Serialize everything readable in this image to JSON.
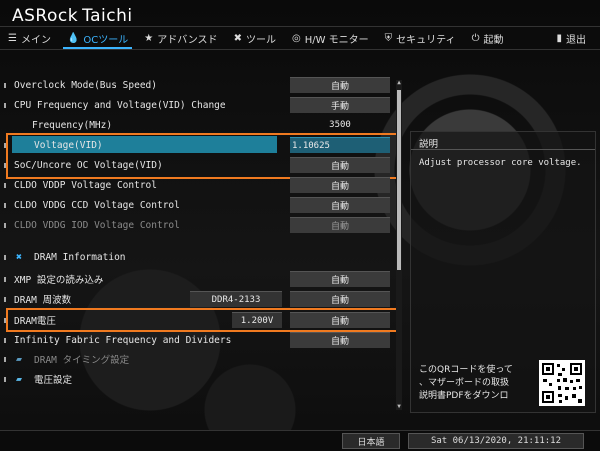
{
  "app": {
    "brand": "ASRock",
    "model": "Taichi"
  },
  "nav": {
    "tabs": [
      {
        "label": "メイン",
        "icon": "list-icon"
      },
      {
        "label": "OCツール",
        "icon": "drop-icon"
      },
      {
        "label": "アドバンスド",
        "icon": "star-icon"
      },
      {
        "label": "ツール",
        "icon": "tools-icon"
      },
      {
        "label": "H/W モニター",
        "icon": "monitor-icon"
      },
      {
        "label": "セキュリティ",
        "icon": "shield-icon"
      },
      {
        "label": "起動",
        "icon": "power-icon"
      },
      {
        "label": "退出",
        "icon": "exit-icon"
      }
    ],
    "active": "OCツール"
  },
  "settings": {
    "overclock_mode": {
      "label": "Overclock Mode(Bus Speed)",
      "value": "自動"
    },
    "cpu_freq_voltage": {
      "label": "CPU Frequency and Voltage(VID) Change",
      "value": "手動"
    },
    "frequency": {
      "label": "Frequency(MHz)",
      "value": "3500"
    },
    "voltage": {
      "label": "Voltage(VID)",
      "value": "1.10625"
    },
    "soc_voltage": {
      "label": "SoC/Uncore OC Voltage(VID)",
      "value": "自動"
    },
    "cldo_vddp": {
      "label": "CLDO VDDP Voltage Control",
      "value": "自動"
    },
    "cldo_vddg_ccd": {
      "label": "CLDO VDDG CCD Voltage Control",
      "value": "自動"
    },
    "cldo_vddg_iod": {
      "label": "CLDO VDDG IOD Voltage Control",
      "value": "自動"
    },
    "dram_info": {
      "label": "DRAM Information"
    },
    "xmp": {
      "label": "XMP 設定の読み込み",
      "value": "自動"
    },
    "dram_freq": {
      "label": "DRAM 周波数",
      "current": "DDR4-2133",
      "value": "自動"
    },
    "dram_voltage": {
      "label": "DRAM電圧",
      "current": "1.200V",
      "value": "自動"
    },
    "infinity_fabric": {
      "label": "Infinity Fabric Frequency and Dividers",
      "value": "自動"
    },
    "dram_timing": {
      "label": "DRAM タイミング設定"
    },
    "voltage_config": {
      "label": "電圧設定"
    }
  },
  "description": {
    "title": "説明",
    "text": "Adjust processor core voltage.",
    "qr_line1": "このQRコードを使って",
    "qr_line2": "、マザーボードの取扱",
    "qr_line3": "説明書PDFをダウンロ"
  },
  "footer": {
    "language": "日本語",
    "datetime": "Sat 06/13/2020, 21:11:12"
  },
  "colors": {
    "accent": "#3cb5ff",
    "highlight": "#1e7f9a",
    "annotation": "#f07a20"
  }
}
